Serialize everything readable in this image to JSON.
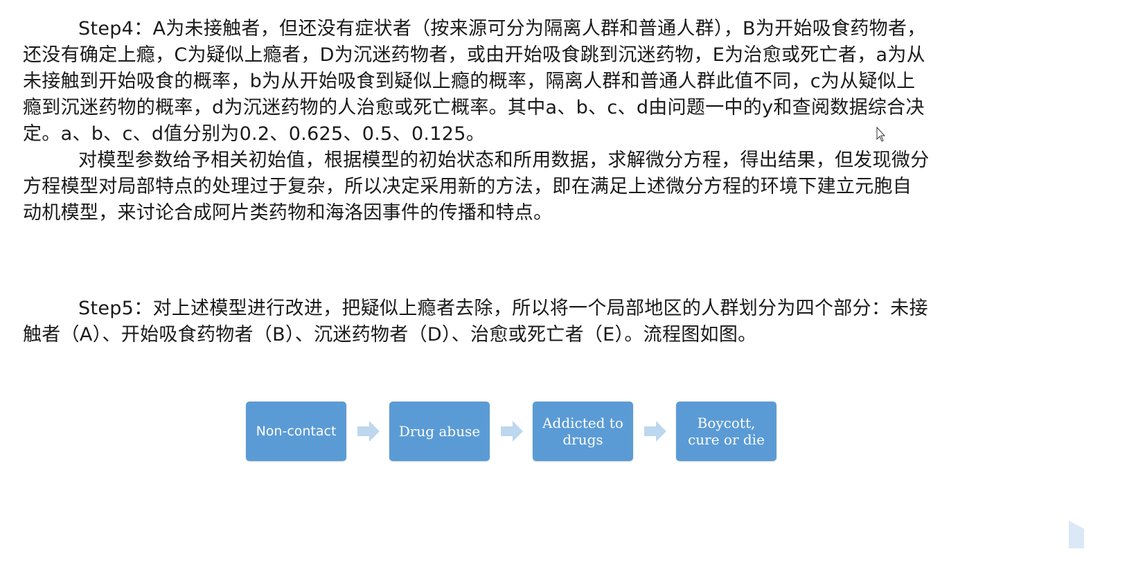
{
  "paragraphs": [
    {
      "lines": [
        "Step4：A为未接触者，但还没有症状者（按来源可分为隔离人群和普通人群），B为开始吸食药物者，",
        "还没有确定上瘾，C为疑似上瘾者，D为沉迷药物者，或由开始吸食跳到沉迷药物，E为治愈或死亡者，a为从",
        "未接触到开始吸食的概率，b为从开始吸食到疑似上瘾的概率，隔离人群和普通人群此值不同，c为从疑似上",
        "瘾到沉迷药物的概率，d为沉迷药物的人治愈或死亡概率。其中a、b、c、d由问题一中的y和查阅数据综合决",
        "定。a、b、c、d值分别为0.2、0.625、0.5、0.125。"
      ]
    },
    {
      "lines": [
        "对模型参数给予相关初始值，根据模型的初始状态和所用数据，求解微分方程，得出结果，但发现微分",
        "方程模型对局部特点的处理过于复杂，所以决定采用新的方法，即在满足上述微分方程的环境下建立元胞自",
        "动机模型，来讨论合成阿片类药物和海洛因事件的传播和特点。"
      ]
    },
    {
      "lines": [
        "Step5：对上述模型进行改进，把疑似上瘾者去除，所以将一个局部地区的人群划分为四个部分：未接",
        "触者（A）、开始吸食药物者（B）、沉迷药物者（D）、治愈或死亡者（E）。流程图如图。"
      ]
    }
  ],
  "flowchart": {
    "nodes": [
      "Non-contact",
      "Drug abuse",
      "Addicted to\ndrugs",
      "Boycott,\ncure or die"
    ],
    "box_color": "#5b9bd5",
    "arrow_color": "#bdd7ee"
  }
}
